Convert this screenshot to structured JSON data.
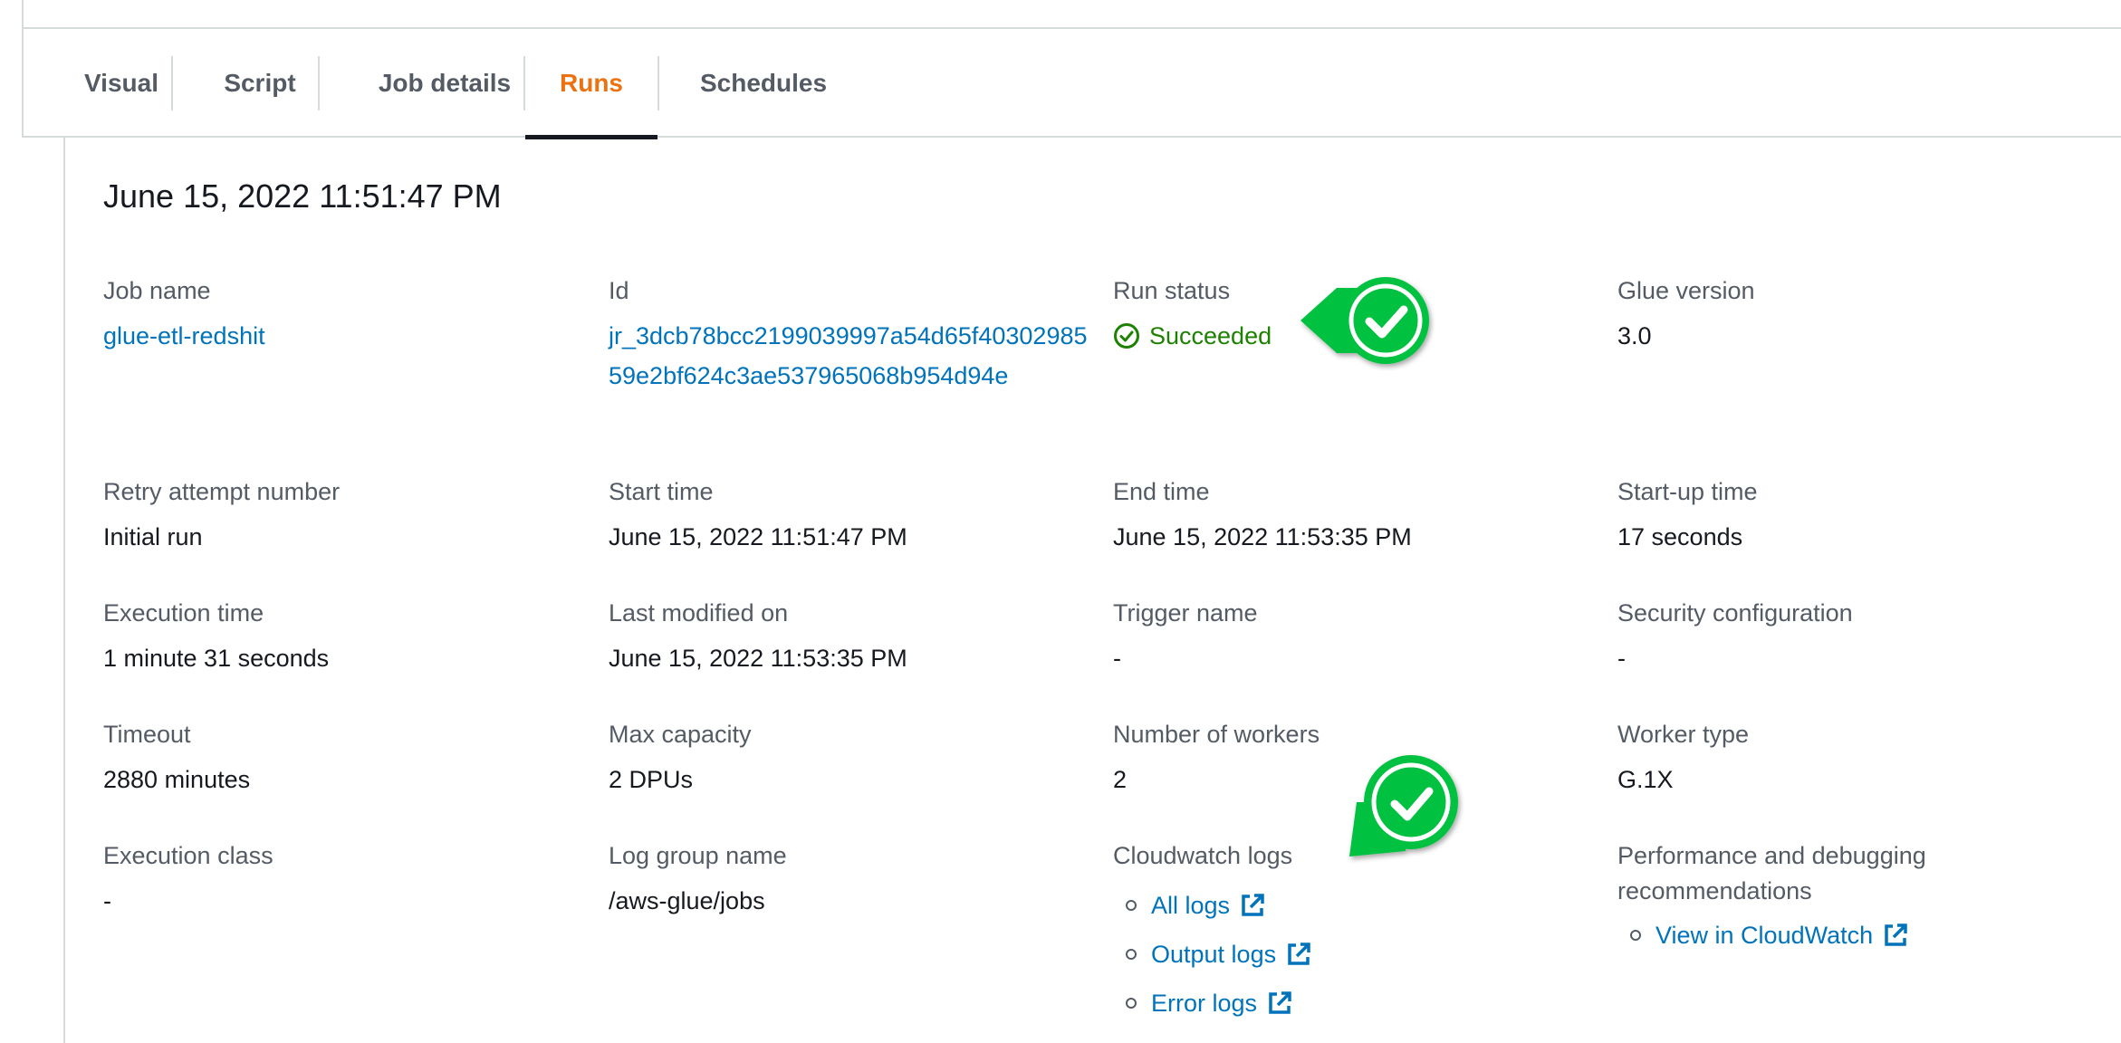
{
  "tabs": [
    {
      "label": "Visual"
    },
    {
      "label": "Script"
    },
    {
      "label": "Job details"
    },
    {
      "label": "Runs",
      "active": true
    },
    {
      "label": "Schedules"
    }
  ],
  "run": {
    "title": "June 15, 2022 11:51:47 PM",
    "fields": {
      "job_name": {
        "label": "Job name",
        "value": "glue-etl-redshit"
      },
      "id": {
        "label": "Id",
        "value": "jr_3dcb78bcc2199039997a54d65f4030298559e2bf624c3ae537965068b954d94e"
      },
      "run_status": {
        "label": "Run status",
        "value": "Succeeded"
      },
      "glue_version": {
        "label": "Glue version",
        "value": "3.0"
      },
      "retry": {
        "label": "Retry attempt number",
        "value": "Initial run"
      },
      "start_time": {
        "label": "Start time",
        "value": "June 15, 2022 11:51:47 PM"
      },
      "end_time": {
        "label": "End time",
        "value": "June 15, 2022 11:53:35 PM"
      },
      "startup_time": {
        "label": "Start-up time",
        "value": "17 seconds"
      },
      "execution_time": {
        "label": "Execution time",
        "value": "1 minute 31 seconds"
      },
      "last_modified": {
        "label": "Last modified on",
        "value": "June 15, 2022 11:53:35 PM"
      },
      "trigger_name": {
        "label": "Trigger name",
        "value": "-"
      },
      "security_config": {
        "label": "Security configuration",
        "value": "-"
      },
      "timeout": {
        "label": "Timeout",
        "value": "2880 minutes"
      },
      "max_capacity": {
        "label": "Max capacity",
        "value": "2 DPUs"
      },
      "num_workers": {
        "label": "Number of workers",
        "value": "2"
      },
      "worker_type": {
        "label": "Worker type",
        "value": "G.1X"
      },
      "execution_class": {
        "label": "Execution class",
        "value": "-"
      },
      "log_group": {
        "label": "Log group name",
        "value": "/aws-glue/jobs"
      },
      "cloudwatch_logs": {
        "label": "Cloudwatch logs",
        "links": [
          "All logs",
          "Output logs",
          "Error logs"
        ]
      },
      "perf": {
        "label": "Performance and debugging recommendations",
        "links": [
          "View in CloudWatch"
        ]
      }
    }
  },
  "colors": {
    "accent": "#ec7211",
    "link": "#0073bb",
    "success": "#1d8102",
    "marker": "#00c13f"
  }
}
